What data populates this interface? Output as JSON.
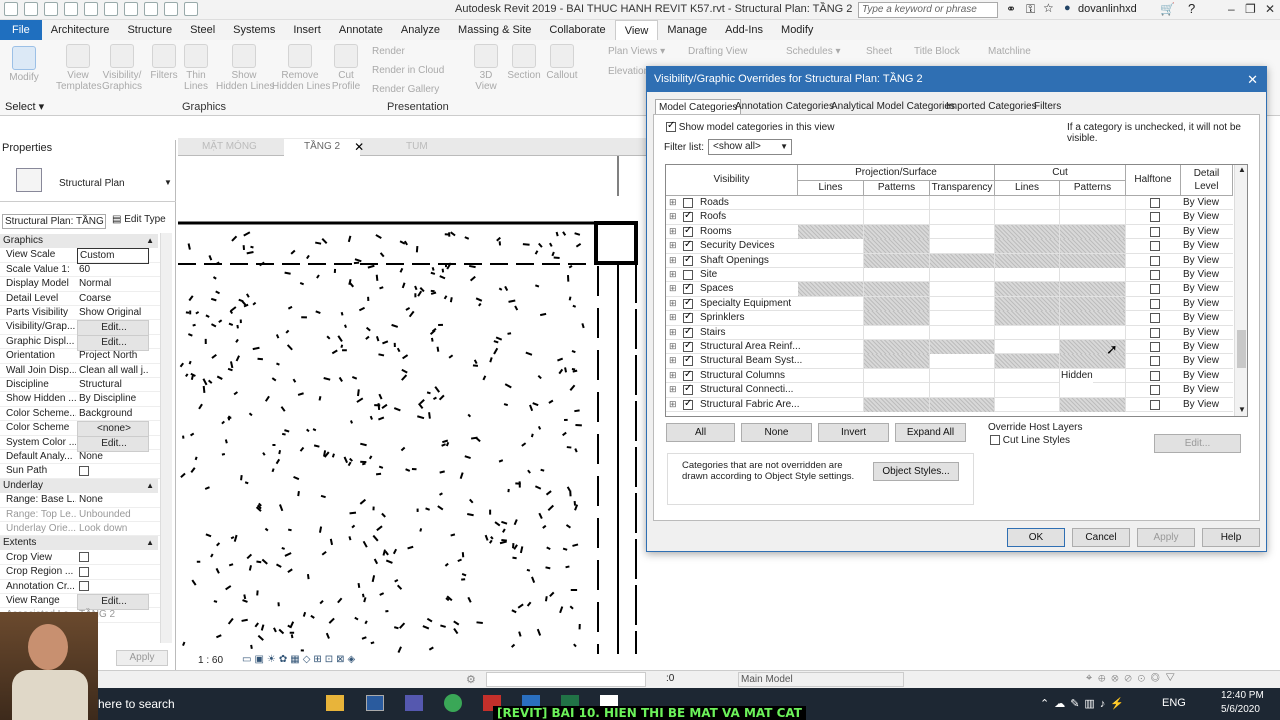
{
  "app": {
    "title": "Autodesk Revit 2019 - BAI THUC HANH REVIT K57.rvt - Structural Plan: TẦNG 2",
    "search_placeholder": "Type a keyword or phrase",
    "user": "dovanlinhxd"
  },
  "ribbon": {
    "tabs": [
      "File",
      "Architecture",
      "Structure",
      "Steel",
      "Systems",
      "Insert",
      "Annotate",
      "Analyze",
      "Massing & Site",
      "Collaborate",
      "View",
      "Manage",
      "Add-Ins",
      "Modify"
    ],
    "active_tab": "View",
    "modify_label": "Modify",
    "select_label": "Select ▾",
    "graphics_buttons": [
      "View\nTemplates",
      "Visibility/\nGraphics",
      "Filters",
      "Thin\nLines",
      "Show\nHidden Lines",
      "Remove\nHidden Lines",
      "Cut\nProfile"
    ],
    "graphics_label": "Graphics",
    "render_items": [
      "Render",
      "Render in Cloud",
      "Render Gallery"
    ],
    "presentation_label": "Presentation",
    "create_items": [
      "3D\nView",
      "Section",
      "Callout"
    ],
    "create_small": [
      "Plan Views ▾",
      "Drafting View",
      "Schedules ▾",
      "Sheet",
      "Title Block",
      "Matchline",
      "Elevation ▾"
    ]
  },
  "properties": {
    "title": "Properties",
    "type_name": "Structural Plan",
    "instance_selector": "Structural Plan: TẦNG",
    "edit_type": "Edit Type",
    "sections": [
      {
        "name": "Graphics",
        "rows": [
          {
            "k": "View Scale",
            "v": "Custom",
            "type": "input"
          },
          {
            "k": "Scale Value    1:",
            "v": "60"
          },
          {
            "k": "Display Model",
            "v": "Normal"
          },
          {
            "k": "Detail Level",
            "v": "Coarse"
          },
          {
            "k": "Parts Visibility",
            "v": "Show Original"
          },
          {
            "k": "Visibility/Grap...",
            "v": "Edit...",
            "type": "btn"
          },
          {
            "k": "Graphic Displ...",
            "v": "Edit...",
            "type": "btn"
          },
          {
            "k": "Orientation",
            "v": "Project North"
          },
          {
            "k": "Wall Join Disp...",
            "v": "Clean all wall j..."
          },
          {
            "k": "Discipline",
            "v": "Structural"
          },
          {
            "k": "Show Hidden ...",
            "v": "By Discipline"
          },
          {
            "k": "Color Scheme...",
            "v": "Background"
          },
          {
            "k": "Color Scheme",
            "v": "<none>",
            "type": "btn"
          },
          {
            "k": "System Color ...",
            "v": "Edit...",
            "type": "btn"
          },
          {
            "k": "Default Analy...",
            "v": "None"
          },
          {
            "k": "Sun Path",
            "v": "",
            "type": "check"
          }
        ]
      },
      {
        "name": "Underlay",
        "rows": [
          {
            "k": "Range: Base L...",
            "v": "None"
          },
          {
            "k": "Range: Top Le...",
            "v": "Unbounded",
            "type": "dim"
          },
          {
            "k": "Underlay Orie...",
            "v": "Look down",
            "type": "dim"
          }
        ]
      },
      {
        "name": "Extents",
        "rows": [
          {
            "k": "Crop View",
            "v": "",
            "type": "check"
          },
          {
            "k": "Crop Region ...",
            "v": "",
            "type": "check"
          },
          {
            "k": "Annotation Cr...",
            "v": "",
            "type": "check"
          },
          {
            "k": "View Range",
            "v": "Edit...",
            "type": "btn"
          },
          {
            "k": "Associated Le...",
            "v": "TẦNG 2",
            "type": "dim"
          }
        ]
      }
    ],
    "apply_label": "Apply"
  },
  "view_tabs": [
    "MẶT MÓNG",
    "TẦNG 2",
    "TUM"
  ],
  "view_scale": "1 : 60",
  "dialog": {
    "title": "Visibility/Graphic Overrides for Structural Plan: TẦNG 2",
    "tabs": [
      "Model Categories",
      "Annotation Categories",
      "Analytical Model Categories",
      "Imported Categories",
      "Filters"
    ],
    "show_model_label": "Show model categories in this view",
    "unchecked_note": "If a category is unchecked, it will not be visible.",
    "filter_label": "Filter list:",
    "filter_value": "<show all>",
    "columns": {
      "visibility": "Visibility",
      "projection": "Projection/Surface",
      "cut": "Cut",
      "lines": "Lines",
      "patterns": "Patterns",
      "transparency": "Transparency",
      "halftone": "Halftone",
      "detail_level": "Detail Level"
    },
    "rows": [
      {
        "name": "Roads",
        "visible": false,
        "hatch": [
          0,
          0,
          0,
          0,
          0
        ],
        "detail": "By View"
      },
      {
        "name": "Roofs",
        "visible": true,
        "hatch": [
          0,
          0,
          0,
          0,
          0
        ],
        "detail": "By View"
      },
      {
        "name": "Rooms",
        "visible": true,
        "hatch": [
          1,
          1,
          0,
          1,
          1
        ],
        "detail": "By View"
      },
      {
        "name": "Security Devices",
        "visible": true,
        "hatch": [
          0,
          1,
          0,
          1,
          1
        ],
        "detail": "By View"
      },
      {
        "name": "Shaft Openings",
        "visible": true,
        "hatch": [
          0,
          1,
          1,
          1,
          1
        ],
        "detail": "By View"
      },
      {
        "name": "Site",
        "visible": false,
        "hatch": [
          0,
          0,
          0,
          0,
          0
        ],
        "detail": "By View"
      },
      {
        "name": "Spaces",
        "visible": true,
        "hatch": [
          1,
          1,
          0,
          1,
          1
        ],
        "detail": "By View"
      },
      {
        "name": "Specialty Equipment",
        "visible": true,
        "hatch": [
          0,
          1,
          0,
          1,
          1
        ],
        "detail": "By View"
      },
      {
        "name": "Sprinklers",
        "visible": true,
        "hatch": [
          0,
          1,
          0,
          1,
          1
        ],
        "detail": "By View"
      },
      {
        "name": "Stairs",
        "visible": true,
        "hatch": [
          0,
          0,
          0,
          0,
          0
        ],
        "detail": "By View"
      },
      {
        "name": "Structural Area Reinf...",
        "visible": true,
        "hatch": [
          0,
          1,
          1,
          0,
          1
        ],
        "detail": "By View"
      },
      {
        "name": "Structural Beam Syst...",
        "visible": true,
        "hatch": [
          0,
          1,
          0,
          1,
          1
        ],
        "detail": "By View"
      },
      {
        "name": "Structural Columns",
        "visible": true,
        "hatch": [
          0,
          0,
          0,
          0,
          0
        ],
        "cut_pattern_text": "Hidden",
        "detail": "By View"
      },
      {
        "name": "Structural Connecti...",
        "visible": true,
        "hatch": [
          0,
          0,
          0,
          0,
          0
        ],
        "detail": "By View"
      },
      {
        "name": "Structural Fabric Are...",
        "visible": true,
        "hatch": [
          0,
          1,
          1,
          0,
          1
        ],
        "detail": "By View"
      }
    ],
    "buttons": {
      "all": "All",
      "none": "None",
      "invert": "Invert",
      "expand": "Expand All"
    },
    "override_host": "Override Host Layers",
    "cut_line_styles": "Cut Line Styles",
    "edit": "Edit...",
    "note": "Categories that are not overridden are drawn according to Object Style settings.",
    "object_styles": "Object Styles...",
    "ok": "OK",
    "cancel": "Cancel",
    "apply": "Apply",
    "help": "Help"
  },
  "statusbar": {
    "zero": ":0",
    "workset": "Main Model"
  },
  "taskbar": {
    "search": "here to search",
    "caption": "[REVIT] BAI 10. HIEN THI BE MAT VA MAT CAT",
    "lang": "ENG",
    "time": "12:40 PM",
    "date": "5/6/2020"
  }
}
